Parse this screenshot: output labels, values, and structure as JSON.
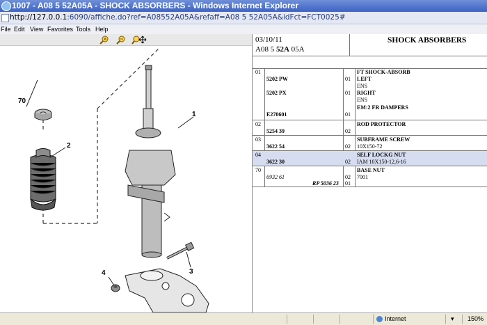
{
  "window": {
    "title": "1007 - A08 5 52A05A - SHOCK ABSORBERS - Windows Internet Explorer",
    "url_host": "http://127.0.0.1",
    "url_rest": ":6090/affiche.do?ref=A08552A05A&refaff=A08 5 52A05A&idFct=FCT0025#"
  },
  "menu": [
    "File",
    "Edit",
    "View",
    "Favorites",
    "Tools",
    "Help"
  ],
  "diagram": {
    "callouts": [
      "70",
      "2",
      "1",
      "3",
      "4"
    ]
  },
  "header": {
    "date": "03/10/11",
    "ref_prefix": "A08 5 ",
    "ref_bold": "52A",
    "ref_suffix": " 05A",
    "title": "SHOCK ABSORBERS"
  },
  "parts": [
    {
      "num": "01",
      "lines": [
        {
          "ref": "",
          "qty": "",
          "desc": "FT SHOCK-ABSORB",
          "desc_bold": true
        },
        {
          "ref": "5202 PW",
          "qty": "01",
          "desc": "LEFT",
          "desc_bold": true
        },
        {
          "ref": "",
          "qty": "",
          "desc": "ENS",
          "desc_bold": false
        },
        {
          "ref": "5202 PX",
          "qty": "01",
          "desc": "RIGHT",
          "desc_bold": true
        },
        {
          "ref": "",
          "qty": "",
          "desc": "ENS",
          "desc_bold": false
        },
        {
          "ref": "",
          "qty": "",
          "desc": "EM:2 FR DAMPERS",
          "desc_bold": true
        },
        {
          "ref": "E270601",
          "qty": "01",
          "desc": "",
          "desc_bold": false
        }
      ]
    },
    {
      "num": "02",
      "lines": [
        {
          "ref": "",
          "qty": "",
          "desc": "ROD PROTECTOR",
          "desc_bold": true
        },
        {
          "ref": "5254 39",
          "qty": "02",
          "desc": "",
          "desc_bold": false
        }
      ]
    },
    {
      "num": "03",
      "lines": [
        {
          "ref": "",
          "qty": "",
          "desc": "SUBFRAME SCREW",
          "desc_bold": true
        },
        {
          "ref": "3622 54",
          "qty": "02",
          "desc": "10X150-72",
          "desc_bold": false
        }
      ]
    },
    {
      "num": "04",
      "highlight": true,
      "lines": [
        {
          "ref": "",
          "qty": "",
          "desc": "SELF LOCKG NUT",
          "desc_bold": true
        },
        {
          "ref": "3622 30",
          "qty": "02",
          "desc": "IAM 10X150-12,6-16",
          "desc_bold": false
        }
      ]
    },
    {
      "num": "70",
      "lines": [
        {
          "ref": "",
          "qty": "",
          "desc": "BASE NUT",
          "desc_bold": true
        },
        {
          "ref": "6932 61",
          "qty": "02",
          "desc": "7001",
          "desc_bold": false
        },
        {
          "ref": "RP 5036 23",
          "qty": "01",
          "desc": "",
          "desc_bold": false
        }
      ]
    }
  ],
  "status": {
    "zone": "Internet",
    "zoom": "150%"
  }
}
